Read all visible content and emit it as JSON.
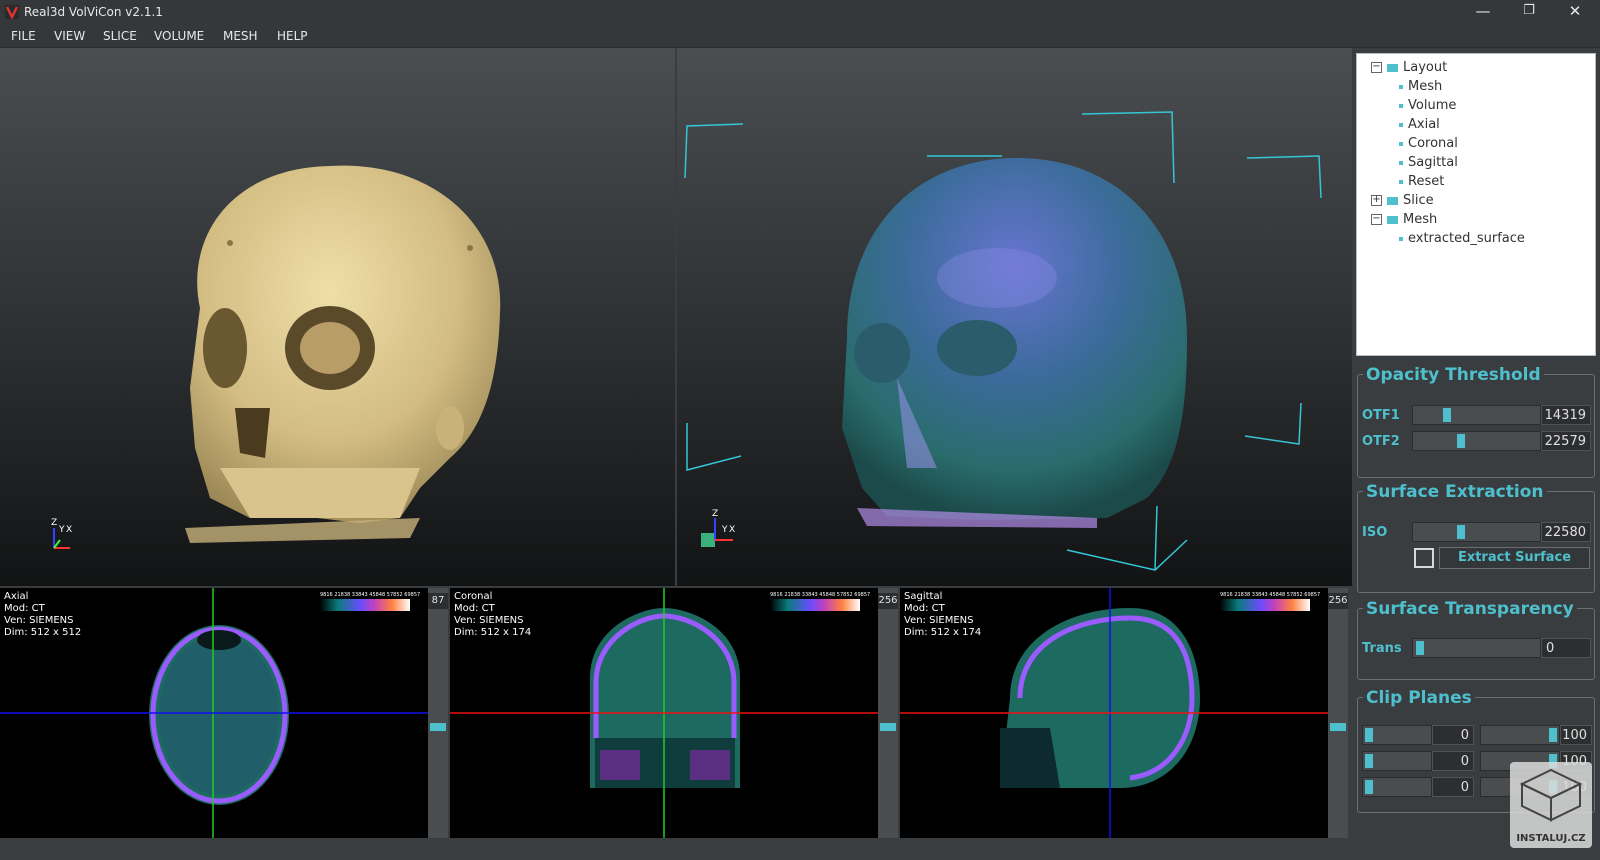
{
  "window": {
    "title": "Real3d VolViCon v2.1.1",
    "controls": [
      "—",
      "❐",
      "✕"
    ]
  },
  "menu": [
    "FILE",
    "VIEW",
    "SLICE",
    "VOLUME",
    "MESH",
    "HELP"
  ],
  "views3d": {
    "mesh": {
      "axis_z": "Z",
      "axis_y": "Y",
      "axis_x": "X"
    },
    "volume": {
      "axis_z": "Z",
      "axis_y": "Y",
      "axis_x": "X"
    }
  },
  "slices": [
    {
      "name": "Axial",
      "mod": "Mod: CT",
      "ven": "Ven: SIEMENS",
      "dim": "Dim: 512 x 512",
      "slider_value": "87",
      "colorbar_ticks": "9816  21838  33843 45848  57852  69857"
    },
    {
      "name": "Coronal",
      "mod": "Mod: CT",
      "ven": "Ven: SIEMENS",
      "dim": "Dim: 512 x 174",
      "slider_value": "256",
      "colorbar_ticks": "9816  21838  33843 45848  57852  69857"
    },
    {
      "name": "Sagittal",
      "mod": "Mod: CT",
      "ven": "Ven: SIEMENS",
      "dim": "Dim: 512 x 174",
      "slider_value": "256",
      "colorbar_ticks": "9816  21838  33843 45848  57852  69857"
    }
  ],
  "tree": {
    "layout": {
      "label": "Layout",
      "children": [
        "Mesh",
        "Volume",
        "Axial",
        "Coronal",
        "Sagittal",
        "Reset"
      ]
    },
    "slice": {
      "label": "Slice"
    },
    "mesh": {
      "label": "Mesh",
      "children": [
        "extracted_surface"
      ]
    }
  },
  "opacity": {
    "title": "Opacity Threshold",
    "otf1_label": "OTF1",
    "otf1_value": "14319",
    "otf2_label": "OTF2",
    "otf2_value": "22579"
  },
  "surface": {
    "title": "Surface Extraction",
    "iso_label": "ISO",
    "iso_value": "22580",
    "button": "Extract Surface"
  },
  "transparency": {
    "title": "Surface Transparency",
    "label": "Trans",
    "value": "0"
  },
  "clip": {
    "title": "Clip Planes",
    "rows": [
      {
        "min": "0",
        "max": "100"
      },
      {
        "min": "0",
        "max": "100"
      },
      {
        "min": "0",
        "max": "100"
      }
    ]
  },
  "watermark": "INSTALUJ.CZ",
  "colors": {
    "accent": "#4ec0cd",
    "background": "#3a3d40"
  }
}
